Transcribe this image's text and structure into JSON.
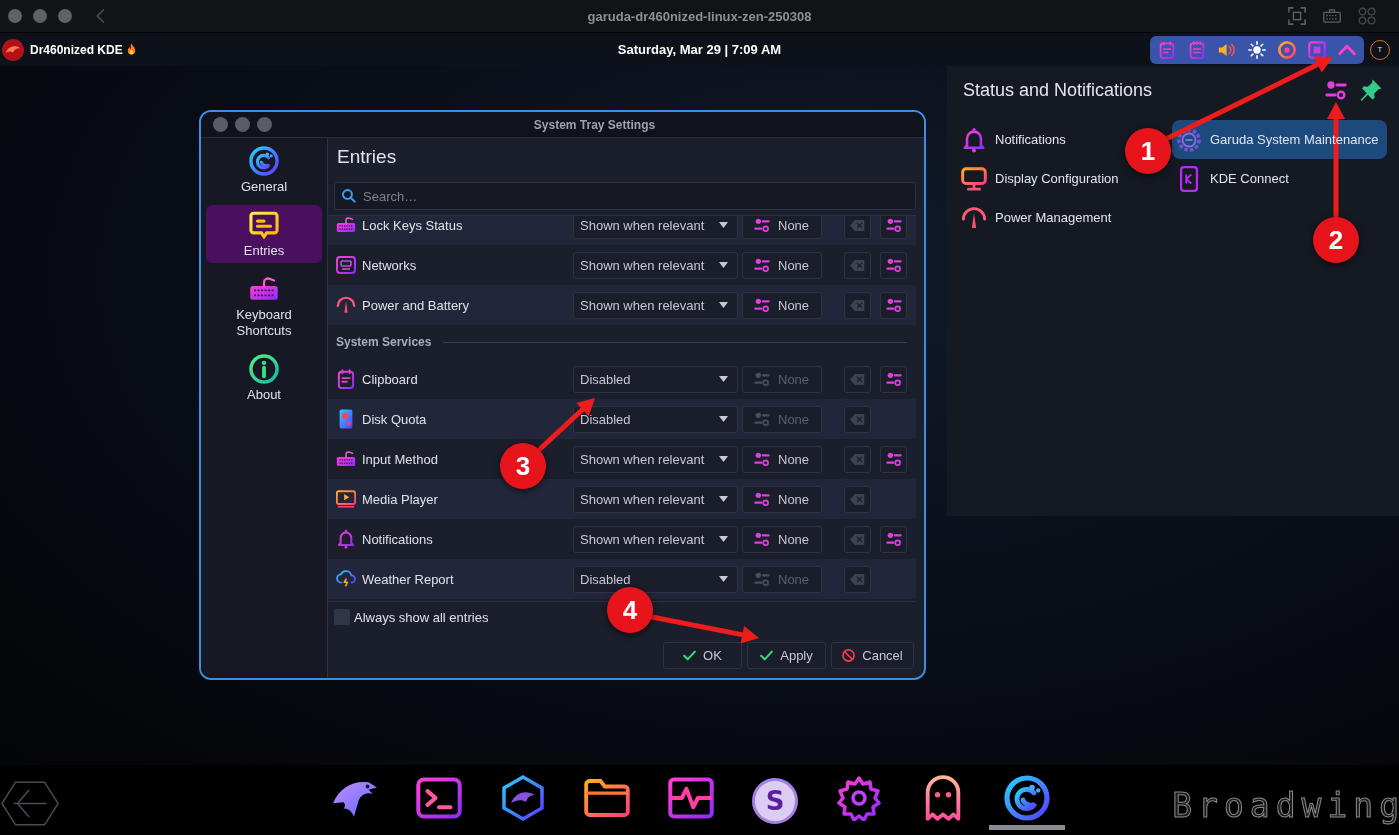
{
  "host_window": {
    "title": "garuda-dr460nized-linux-zen-250308"
  },
  "panel": {
    "menu_label": "Dr460nized KDE",
    "clock": "Saturday, Mar 29 | 7:09 AM",
    "user_initial": "T"
  },
  "tray_popup": {
    "title": "Status and Notifications",
    "items": [
      {
        "label": "Notifications",
        "selected": false
      },
      {
        "label": "Display Configuration",
        "selected": false
      },
      {
        "label": "Power Management",
        "selected": false
      },
      {
        "label": "Garuda System Maintenance",
        "selected": true
      },
      {
        "label": "KDE Connect",
        "selected": false
      }
    ]
  },
  "dialog": {
    "title": "System Tray Settings",
    "sidebar": [
      {
        "label": "General",
        "selected": false
      },
      {
        "label": "Entries",
        "selected": true
      },
      {
        "label": "Keyboard Shortcuts",
        "selected": false
      },
      {
        "label": "About",
        "selected": false
      }
    ],
    "heading": "Entries",
    "search": {
      "placeholder": "Search…"
    },
    "sections": [
      {
        "rows": [
          {
            "name": "Lock Keys Status",
            "visibility": "Shown when relevant",
            "shortcut": "None",
            "shortcut_disabled": false,
            "clear_disabled": true,
            "has_settings": true
          },
          {
            "name": "Networks",
            "visibility": "Shown when relevant",
            "shortcut": "None",
            "shortcut_disabled": false,
            "clear_disabled": true,
            "has_settings": true
          },
          {
            "name": "Power and Battery",
            "visibility": "Shown when relevant",
            "shortcut": "None",
            "shortcut_disabled": false,
            "clear_disabled": true,
            "has_settings": true
          }
        ]
      },
      {
        "title": "System Services",
        "rows": [
          {
            "name": "Clipboard",
            "visibility": "Disabled",
            "shortcut": "None",
            "shortcut_disabled": true,
            "clear_disabled": true,
            "has_settings": true
          },
          {
            "name": "Disk Quota",
            "visibility": "Disabled",
            "shortcut": "None",
            "shortcut_disabled": true,
            "clear_disabled": true,
            "has_settings": false
          },
          {
            "name": "Input Method",
            "visibility": "Shown when relevant",
            "shortcut": "None",
            "shortcut_disabled": false,
            "clear_disabled": true,
            "has_settings": true
          },
          {
            "name": "Media Player",
            "visibility": "Shown when relevant",
            "shortcut": "None",
            "shortcut_disabled": false,
            "clear_disabled": true,
            "has_settings": false
          },
          {
            "name": "Notifications",
            "visibility": "Shown when relevant",
            "shortcut": "None",
            "shortcut_disabled": false,
            "clear_disabled": true,
            "has_settings": true
          },
          {
            "name": "Weather Report",
            "visibility": "Disabled",
            "shortcut": "None",
            "shortcut_disabled": true,
            "clear_disabled": true,
            "has_settings": false
          }
        ]
      }
    ],
    "always_show_all": {
      "label": "Always show all entries",
      "checked": false
    },
    "buttons": [
      {
        "label": "OK",
        "kind": "ok"
      },
      {
        "label": "Apply",
        "kind": "apply"
      },
      {
        "label": "Cancel",
        "kind": "cancel"
      }
    ]
  },
  "dock": {
    "items": [
      {
        "active": false
      },
      {
        "active": false
      },
      {
        "active": false
      },
      {
        "active": false
      },
      {
        "active": false
      },
      {
        "active": false,
        "glyph": "S"
      },
      {
        "active": false
      },
      {
        "active": false
      },
      {
        "active": true
      }
    ]
  },
  "wallpaper": {
    "text": "Broadwing"
  },
  "annotations": [
    {
      "label": "1"
    },
    {
      "label": "2"
    },
    {
      "label": "3"
    },
    {
      "label": "4"
    }
  ]
}
